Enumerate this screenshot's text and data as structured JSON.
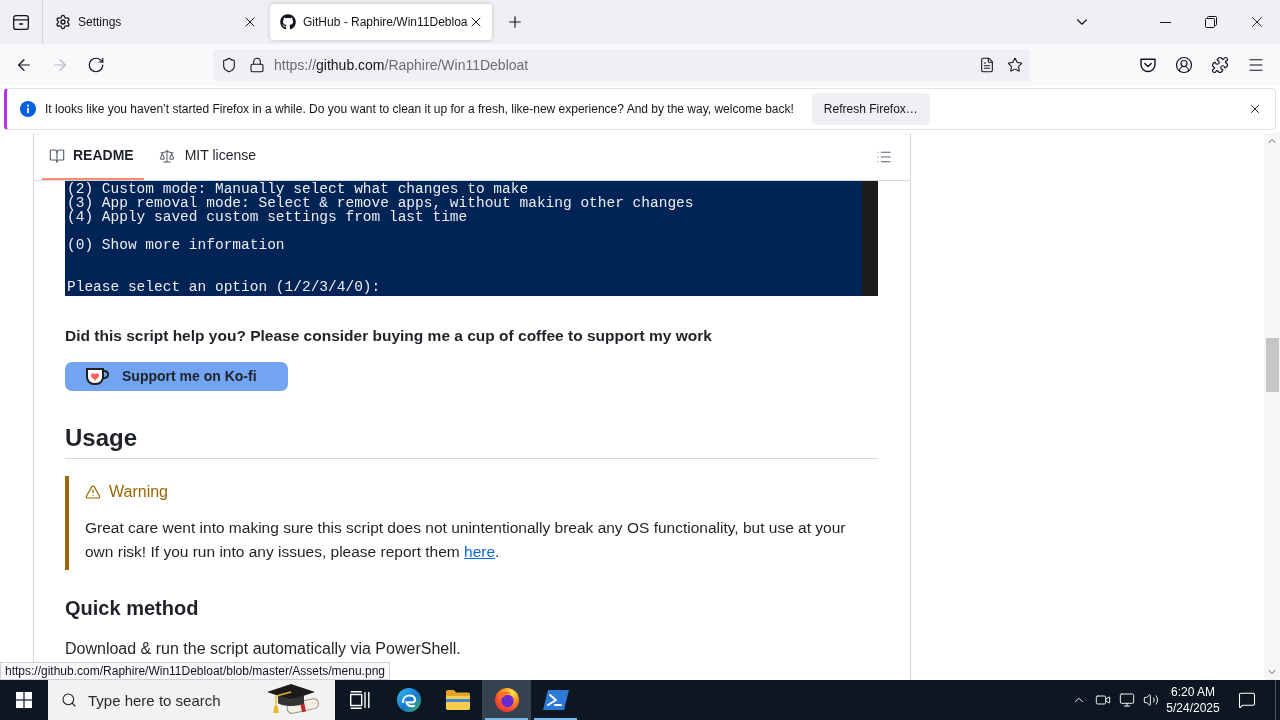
{
  "browser": {
    "tabs": [
      {
        "kind": "settings",
        "title": "Settings",
        "selected": false
      },
      {
        "kind": "web",
        "title": "GitHub - Raphire/Win11Debloa",
        "selected": true
      }
    ],
    "nav_buttons": [
      {
        "kind": "back",
        "disabled": false
      },
      {
        "kind": "forward",
        "disabled": true
      },
      {
        "kind": "reload",
        "disabled": false
      }
    ],
    "url": {
      "scheme": "https://",
      "host": "github.com",
      "path": "/Raphire/Win11Debloat"
    }
  },
  "notification": {
    "message": "It looks like you haven’t started Firefox in a while. Do you want to clean it up for a fresh, like-new experience? And by the way, welcome back!",
    "button": "Refresh Firefox…"
  },
  "readme": {
    "tabs": [
      {
        "kind": "readme",
        "label": "README",
        "selected": true
      },
      {
        "kind": "license",
        "label": "MIT license",
        "selected": false
      }
    ],
    "terminal_groups": [
      [
        "(2) Custom mode: Manually select what changes to make",
        "(3) App removal mode: Select & remove apps, without making other changes",
        "(4) Apply saved custom settings from last time"
      ],
      [
        "(0) Show more information"
      ],
      [
        "Please select an option (1/2/3/4/0):"
      ]
    ],
    "support_text": "Did this script help you? Please consider buying me a cup of coffee to support my work",
    "kofi_button": "Support me on Ko-fi",
    "usage_heading": "Usage",
    "warning": {
      "title": "Warning",
      "text": "Great care went into making sure this script does not unintentionally break any OS functionality, but use at your own risk! If you run into any issues, please report them",
      "link": "here",
      "end": "."
    },
    "quick_method_heading": "Quick method",
    "quick_method_text": "Download & run the script automatically via PowerShell."
  },
  "status_url": "https://github.com/Raphire/Win11Debloat/blob/master/Assets/menu.png",
  "taskbar": {
    "search_placeholder": "Type here to search",
    "apps": [
      {
        "kind": "task-view",
        "selected": false,
        "running": false
      },
      {
        "kind": "edge",
        "selected": false,
        "running": false
      },
      {
        "kind": "file-explorer",
        "selected": false,
        "running": false
      },
      {
        "kind": "firefox",
        "selected": true,
        "running": true
      },
      {
        "kind": "powershell",
        "selected": false,
        "running": true
      }
    ],
    "time": "6:20 AM",
    "date": "5/24/2025"
  }
}
